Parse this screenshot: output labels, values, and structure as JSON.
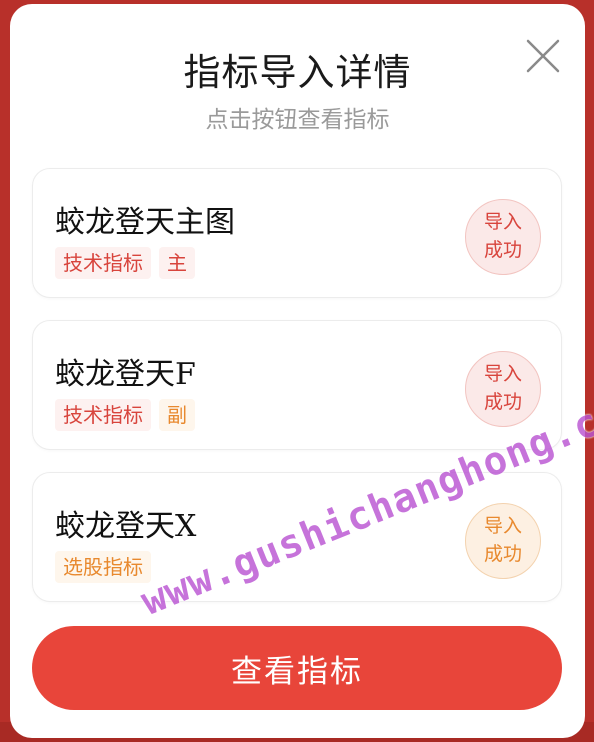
{
  "dialog": {
    "title": "指标导入详情",
    "subtitle": "点击按钮查看指标",
    "close_icon": "close-icon"
  },
  "indicators": [
    {
      "name": "蛟龙登天主图",
      "tags": [
        {
          "label": "技术指标",
          "color": "#d8443c"
        },
        {
          "label": "主",
          "color": "#d8443c"
        }
      ],
      "status_line1": "导入",
      "status_line2": "成功",
      "status_color": "#d8443c"
    },
    {
      "name": "蛟龙登天F",
      "tags": [
        {
          "label": "技术指标",
          "color": "#d8443c"
        },
        {
          "label": "副",
          "color": "#e8892e"
        }
      ],
      "status_line1": "导入",
      "status_line2": "成功",
      "status_color": "#d8443c"
    },
    {
      "name": "蛟龙登天X",
      "tags": [
        {
          "label": "选股指标",
          "color": "#e8892e"
        }
      ],
      "status_line1": "导入",
      "status_line2": "成功",
      "status_color": "#e8892e"
    }
  ],
  "view_button": {
    "label": "查看指标",
    "color": "#e8453a"
  },
  "watermark": "www.gushichanghong.com"
}
